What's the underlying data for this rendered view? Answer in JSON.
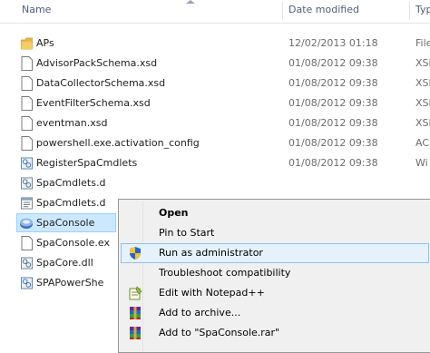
{
  "columns": {
    "name": "Name",
    "date_modified": "Date modified",
    "type": "Typ"
  },
  "files": [
    {
      "name": "APs",
      "date": "12/02/2013 01:18",
      "type": "File",
      "icon": "folder-icon"
    },
    {
      "name": "AdvisorPackSchema.xsd",
      "date": "01/08/2012 09:38",
      "type": "XSI",
      "icon": "file-icon"
    },
    {
      "name": "DataCollectorSchema.xsd",
      "date": "01/08/2012 09:38",
      "type": "XSI",
      "icon": "file-icon"
    },
    {
      "name": "EventFilterSchema.xsd",
      "date": "01/08/2012 09:38",
      "type": "XSI",
      "icon": "file-icon"
    },
    {
      "name": "eventman.xsd",
      "date": "01/08/2012 09:38",
      "type": "XSI",
      "icon": "file-icon"
    },
    {
      "name": "powershell.exe.activation_config",
      "date": "01/08/2012 09:38",
      "type": "AC",
      "icon": "file-icon"
    },
    {
      "name": "RegisterSpaCmdlets",
      "date": "01/08/2012 09:38",
      "type": "Wi",
      "icon": "script-icon"
    },
    {
      "name": "SpaCmdlets.d",
      "date": "",
      "type": "",
      "icon": "dll-icon"
    },
    {
      "name": "SpaCmdlets.d",
      "date": "",
      "type": "",
      "icon": "text-file-icon"
    },
    {
      "name": "SpaConsole",
      "date": "",
      "type": "",
      "icon": "console-app-icon"
    },
    {
      "name": "SpaConsole.ex",
      "date": "",
      "type": "",
      "icon": "file-icon"
    },
    {
      "name": "SpaCore.dll",
      "date": "",
      "type": "",
      "icon": "dll-icon"
    },
    {
      "name": "SPAPowerShe",
      "date": "",
      "type": "",
      "icon": "script-icon"
    }
  ],
  "context_menu": {
    "items": [
      {
        "label": "Open",
        "icon": ""
      },
      {
        "label": "Pin to Start",
        "icon": ""
      },
      {
        "label": "Run as administrator",
        "icon": "uac-shield-icon"
      },
      {
        "label": "Troubleshoot compatibility",
        "icon": ""
      },
      {
        "label": "Edit with Notepad++",
        "icon": "notepad-plus-plus-icon"
      },
      {
        "label": "Add to archive...",
        "icon": "winrar-icon"
      },
      {
        "label": "Add to \"SpaConsole.rar\"",
        "icon": "winrar-icon"
      }
    ]
  },
  "colors": {
    "selection_bg": "#cce8ff",
    "selection_border": "#99d1ff",
    "menu_highlight_bg": "#e5f1fb",
    "menu_highlight_border": "#8fc3ec",
    "folder": "#e8b94a"
  }
}
